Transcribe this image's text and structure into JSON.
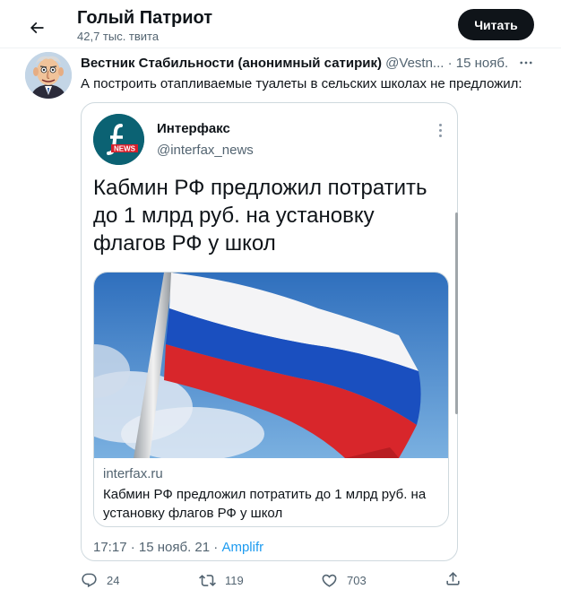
{
  "header": {
    "title": "Голый Патриот",
    "subtitle": "42,7 тыс. твита",
    "follow_label": "Читать"
  },
  "tweet": {
    "author_name": "Вестник Стабильности (анонимный сатирик)",
    "author_handle": "@Vestn...",
    "separator": "·",
    "date": "15 нояб.",
    "text": "А построить отапливаемые туалеты в сельских школах не предложил:",
    "actions": {
      "replies": "24",
      "retweets": "119",
      "likes": "703"
    }
  },
  "quote": {
    "author_name": "Интерфакс",
    "author_handle": "@interfax_news",
    "text": "Кабмин РФ предложил потратить до 1 млрд руб. на установку флагов РФ у школ",
    "link_card": {
      "domain": "interfax.ru",
      "title": "Кабмин РФ предложил потратить до 1 млрд руб. на установку флагов РФ у школ"
    },
    "meta": {
      "time": "17:17",
      "separator1": "·",
      "date": "15 нояб. 21",
      "separator2": "·",
      "source": "Amplifr"
    },
    "logo_text": "NEWS"
  },
  "colors": {
    "text": "#0f1419",
    "secondary": "#536471",
    "link": "#1d9bf0",
    "border": "#cfd9de",
    "button_bg": "#0f1419"
  },
  "icons": [
    "back-arrow-icon",
    "more-icon",
    "reply-icon",
    "retweet-icon",
    "like-icon",
    "share-icon"
  ]
}
